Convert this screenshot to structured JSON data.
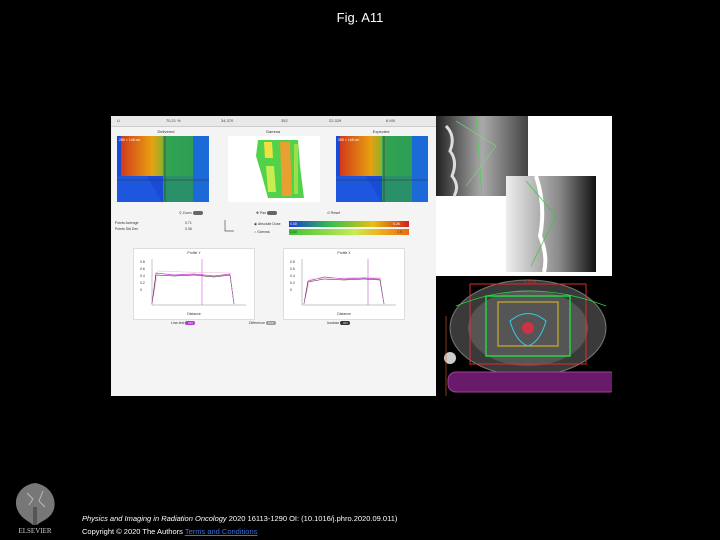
{
  "figure_title": "Fig. A11",
  "app": {
    "top_bar": [
      "U",
      "70.21 %",
      "34.370",
      "352",
      "22.329",
      "6 MV"
    ],
    "panels": [
      "Delivered",
      "Gamma",
      "Expected"
    ],
    "map_corner_text": "285 × 148 cm",
    "controls": {
      "zoom_label": "Zoom",
      "pan_label": "Pan",
      "reset_label": "Reset",
      "points_average_label": "Points Average",
      "points_average_value": "0.71",
      "points_std_dev_label": "Points Std Dev",
      "points_std_dev_value": "0.36",
      "absolute_dose_label": "Absolute Dose",
      "absolute_dose_min": "0.00",
      "absolute_dose_max": "0.26",
      "gamma_label": "Gamma",
      "gamma_min": "0.00",
      "gamma_max": "1.5"
    },
    "profiles": [
      {
        "title": "Profile Y",
        "xlabel": "Distance"
      },
      {
        "title": "Profile X",
        "xlabel": "Distance"
      }
    ],
    "profile_yticks": [
      "0.8",
      "0.6",
      "0.4",
      "0.2",
      "0"
    ],
    "bottom_toggles": [
      {
        "label": "Line-test",
        "state": "ON"
      },
      {
        "label": "Difference",
        "state": "OFF"
      },
      {
        "label": "Isodose",
        "state": "ON"
      }
    ]
  },
  "ct": {
    "label_top": "0.3128"
  },
  "footer": {
    "journal": "Physics and Imaging in Radiation Oncology",
    "citation": " 2020 16113-1290 OI: (10.1016/j.phro.2020.09.011)",
    "copyright": "Copyright © 2020 The Authors",
    "link": "Terms and Conditions"
  },
  "logo_text": "ELSEVIER"
}
